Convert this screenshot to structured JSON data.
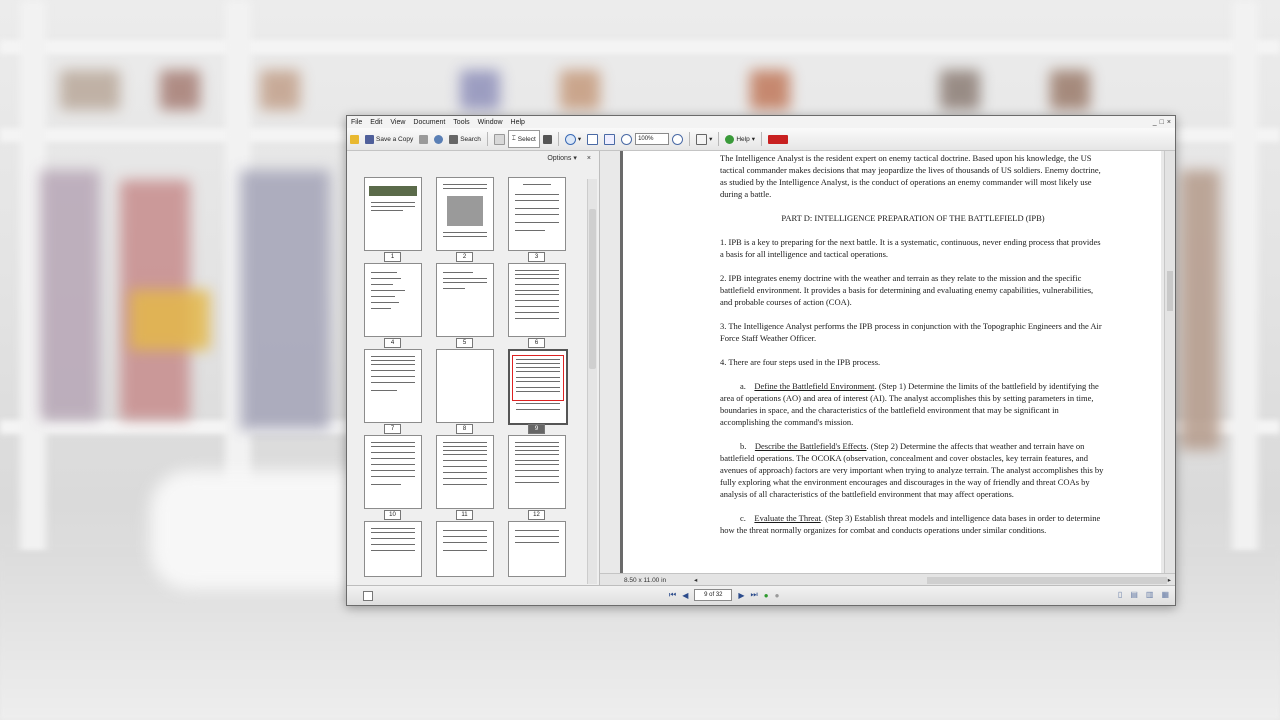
{
  "menu": [
    "File",
    "Edit",
    "View",
    "Document",
    "Tools",
    "Window",
    "Help"
  ],
  "window_controls": [
    "_",
    "□",
    "×"
  ],
  "toolbar": {
    "save_copy": "Save a Copy",
    "search": "Search",
    "select": "Select",
    "zoom": "100%",
    "help": "Help"
  },
  "left_pane": {
    "options": "Options ▾",
    "close": "×",
    "thumbnails": [
      "1",
      "2",
      "3",
      "4",
      "5",
      "6",
      "7",
      "8",
      "9",
      "10",
      "11",
      "12"
    ],
    "selected_page": "9"
  },
  "document": {
    "p1": "The Intelligence Analyst is the resident expert on enemy tactical doctrine.  Based upon his knowledge, the US tactical commander makes decisions that may jeopardize the lives of thousands of US soldiers.  Enemy doctrine, as studied by the Intelligence Analyst, is the conduct of operations an enemy commander will most likely use during a battle.",
    "heading": "PART D: INTELLIGENCE PREPARATION OF THE BATTLEFIELD (IPB)",
    "p2": "1.   IPB is a key to preparing for the next battle.  It is a systematic, continuous, never ending process that provides a basis for all intelligence and tactical operations.",
    "p3": "2.   IPB integrates enemy doctrine with the weather and terrain as they relate to the mission and the specific battlefield environment.  It provides a basis for determining and evaluating enemy capabilities, vulnerabilities, and probable courses of action (COA).",
    "p4": "3.   The Intelligence Analyst performs the IPB process in conjunction with the Topographic Engineers and the Air Force Staff Weather Officer.",
    "p5": "4.   There are four steps used in the IPB process.",
    "a_label": "a.",
    "a_title": "Define the Battlefield Environment",
    "a_text": ".  (Step 1) Determine the limits of the battlefield by identifying the area of operations (AO) and area of interest (AI).  The analyst accomplishes this by setting parameters in time, boundaries in space, and the characteristics of the battlefield environment that may be significant in accomplishing the command's mission.",
    "b_label": "b.",
    "b_title": "Describe the Battlefield's Effects",
    "b_text": ".  (Step 2) Determine the affects that weather and terrain have on battlefield operations.  The OCOKA (observation, concealment and cover obstacles, key terrain features, and avenues of approach) factors are very important when trying to analyze terrain.  The analyst accomplishes this by fully exploring what the environment encourages and discourages in the way of friendly and threat COAs by analysis of all characteristics of the battlefield environment that may affect operations.",
    "c_label": "c.",
    "c_title": "Evaluate the Threat",
    "c_text": ".  (Step 3) Establish threat models and intelligence data bases in order to determine how the threat normally organizes for combat and conducts operations under similar conditions."
  },
  "page_size": "8.50 x 11.00 in",
  "status": {
    "page_indicator": "9 of 32"
  }
}
